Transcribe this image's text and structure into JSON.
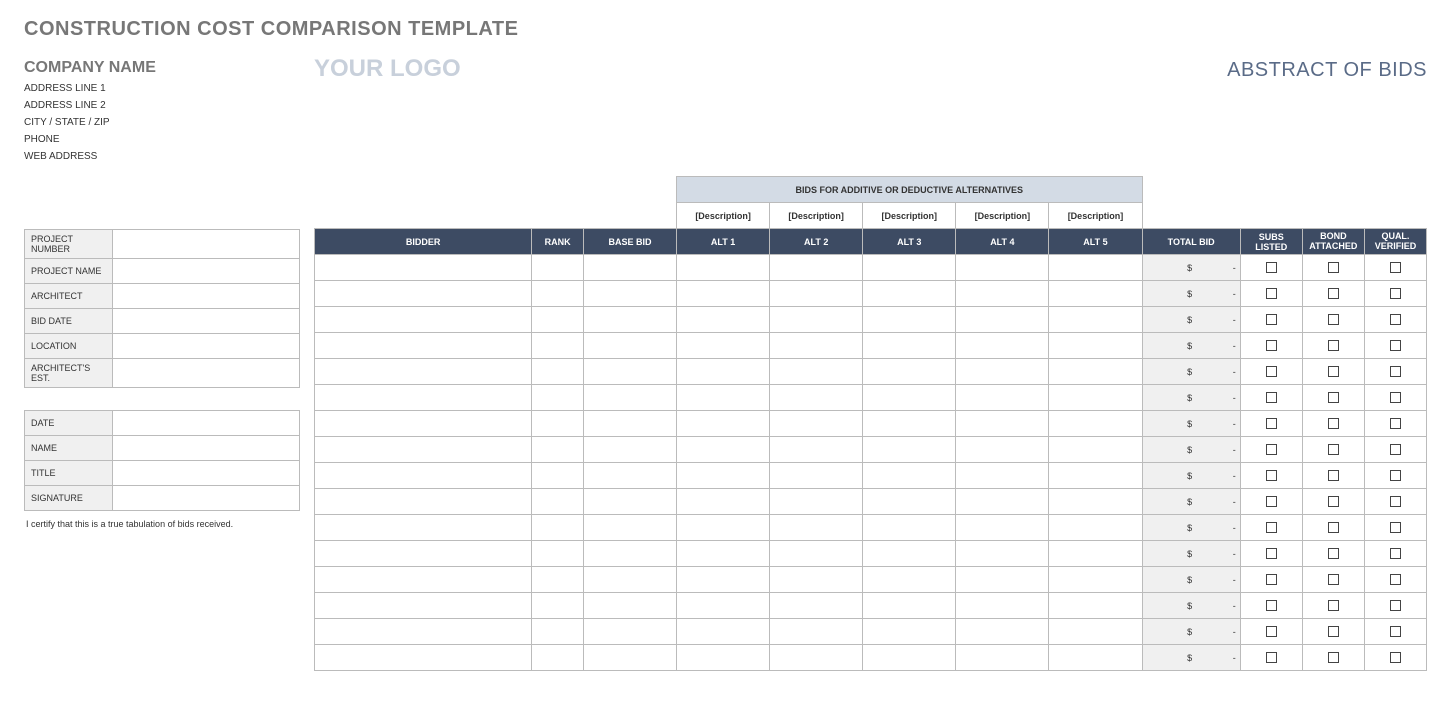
{
  "title": "CONSTRUCTION COST COMPARISON TEMPLATE",
  "company": {
    "name": "COMPANY NAME",
    "address1": "ADDRESS LINE 1",
    "address2": "ADDRESS LINE 2",
    "citystatezip": "CITY / STATE / ZIP",
    "phone": "PHONE",
    "web": "WEB ADDRESS"
  },
  "logo_text": "YOUR LOGO",
  "abstract_heading": "ABSTRACT OF BIDS",
  "project_info_labels": {
    "project_number": "PROJECT NUMBER",
    "project_name": "PROJECT NAME",
    "architect": "ARCHITECT",
    "bid_date": "BID DATE",
    "location": "LOCATION",
    "architects_est": "ARCHITECT'S EST."
  },
  "project_info_values": {
    "project_number": "",
    "project_name": "",
    "architect": "",
    "bid_date": "",
    "location": "",
    "architects_est": ""
  },
  "signoff_labels": {
    "date": "DATE",
    "name": "NAME",
    "title": "TITLE",
    "signature": "SIGNATURE"
  },
  "signoff_values": {
    "date": "",
    "name": "",
    "title": "",
    "signature": ""
  },
  "certify_text": "I certify that this is a true tabulation of bids received.",
  "alt_superheader": "BIDS FOR ADDITIVE OR DEDUCTIVE ALTERNATIVES",
  "alt_descriptions": [
    "[Description]",
    "[Description]",
    "[Description]",
    "[Description]",
    "[Description]"
  ],
  "columns": {
    "bidder": "BIDDER",
    "rank": "RANK",
    "base_bid": "BASE BID",
    "alt1": "ALT 1",
    "alt2": "ALT 2",
    "alt3": "ALT 3",
    "alt4": "ALT 4",
    "alt5": "ALT 5",
    "total_bid": "TOTAL BID",
    "subs_listed": "SUBS LISTED",
    "bond_attached": "BOND ATTACHED",
    "qual_verified": "QUAL. VERIFIED"
  },
  "total_bid_placeholder": {
    "currency": "$",
    "dash": "-"
  },
  "row_count": 16
}
